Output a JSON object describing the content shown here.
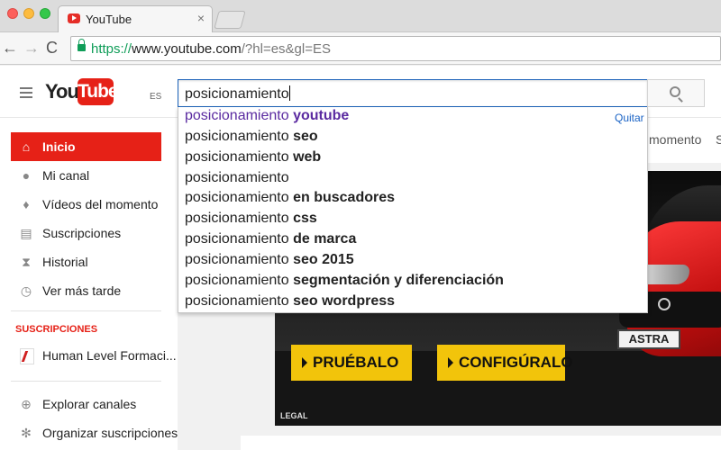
{
  "browser": {
    "tab_title": "YouTube",
    "tab_close": "×",
    "url_scheme": "https://",
    "url_host": "www.youtube.com",
    "url_path": "/?hl=es&gl=ES",
    "nav": {
      "back": "←",
      "forward": "→",
      "reload": "C"
    }
  },
  "youtube": {
    "logo_you": "You",
    "logo_tube": "Tube",
    "logo_country": "ES",
    "search_value": "posicionamiento",
    "suggestions": [
      {
        "base": "posicionamiento",
        "completion": "youtube"
      },
      {
        "base": "posicionamiento",
        "completion": "seo"
      },
      {
        "base": "posicionamiento",
        "completion": "web"
      },
      {
        "base": "posicionamiento",
        "completion": ""
      },
      {
        "base": "posicionamiento",
        "completion": "en buscadores"
      },
      {
        "base": "posicionamiento",
        "completion": "css"
      },
      {
        "base": "posicionamiento",
        "completion": "de marca"
      },
      {
        "base": "posicionamiento",
        "completion": "seo 2015"
      },
      {
        "base": "posicionamiento",
        "completion": "segmentación y diferenciación"
      },
      {
        "base": "posicionamiento",
        "completion": "seo wordpress"
      }
    ],
    "remove_label": "Quitar",
    "sidebar": {
      "items": [
        {
          "label": "Inicio",
          "icon": "home-icon"
        },
        {
          "label": "Mi canal",
          "icon": "account-icon"
        },
        {
          "label": "Vídeos del momento",
          "icon": "flame-icon"
        },
        {
          "label": "Suscripciones",
          "icon": "subscriptions-icon"
        },
        {
          "label": "Historial",
          "icon": "hourglass-icon"
        },
        {
          "label": "Ver más tarde",
          "icon": "clock-icon"
        }
      ],
      "subscriptions_heading": "SUSCRIPCIONES",
      "subscriptions": [
        {
          "label": "Human Level Formaci..."
        }
      ],
      "footer_items": [
        {
          "label": "Explorar canales",
          "icon": "plus-circle-icon"
        },
        {
          "label": "Organizar suscripciones",
          "icon": "gear-icon"
        }
      ]
    },
    "tabs_partial": {
      "momento": "momento",
      "s": "S"
    },
    "ad": {
      "button_1": "PRUÉBALO",
      "button_2": "CONFIGÚRALO",
      "plate": "ASTRA",
      "legal": "LEGAL"
    }
  },
  "colors": {
    "brand_red": "#e62117",
    "link_blue": "#1a63c5",
    "ad_yellow": "#f2c40b"
  }
}
